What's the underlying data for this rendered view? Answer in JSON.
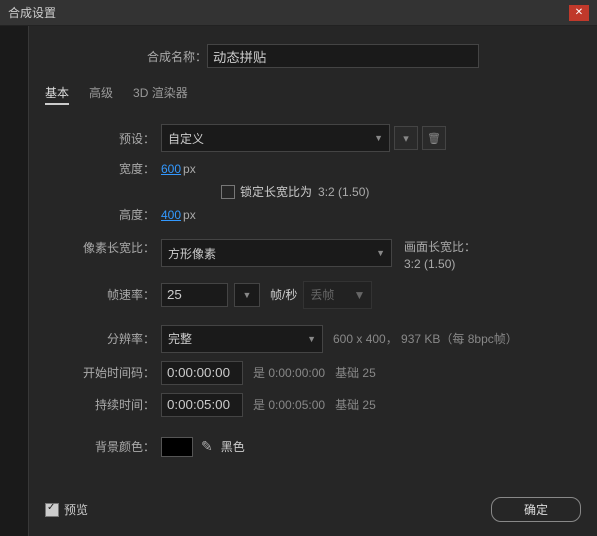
{
  "title": "合成设置",
  "name_label": "合成名称：",
  "name_value": "动态拼贴",
  "tabs": {
    "basic": "基本",
    "advanced": "高级",
    "renderer": "3D 渲染器"
  },
  "preset_label": "预设：",
  "preset_value": "自定义",
  "width_label": "宽度：",
  "width_value": "600",
  "width_unit": "px",
  "height_label": "高度：",
  "height_value": "400",
  "height_unit": "px",
  "lock_aspect": "锁定长宽比为",
  "lock_ratio": "3:2 (1.50)",
  "par_label": "像素长宽比：",
  "par_value": "方形像素",
  "frame_aspect_label": "画面长宽比：",
  "frame_aspect_value": "3:2 (1.50)",
  "fps_label": "帧速率：",
  "fps_value": "25",
  "fps_unit": "帧/秒",
  "drop_value": "丢帧",
  "res_label": "分辨率：",
  "res_value": "完整",
  "res_info": "600 x 400， 937 KB（每 8bpc帧）",
  "start_label": "开始时间码：",
  "start_value": "0:00:00:00",
  "start_is": "是 0:00:00:00",
  "start_base": "基础 25",
  "dur_label": "持续时间：",
  "dur_value": "0:00:05:00",
  "dur_is": "是 0:00:05:00",
  "dur_base": "基础 25",
  "bg_label": "背景颜色：",
  "bg_name": "黑色",
  "preview": "预览",
  "ok": "确定"
}
